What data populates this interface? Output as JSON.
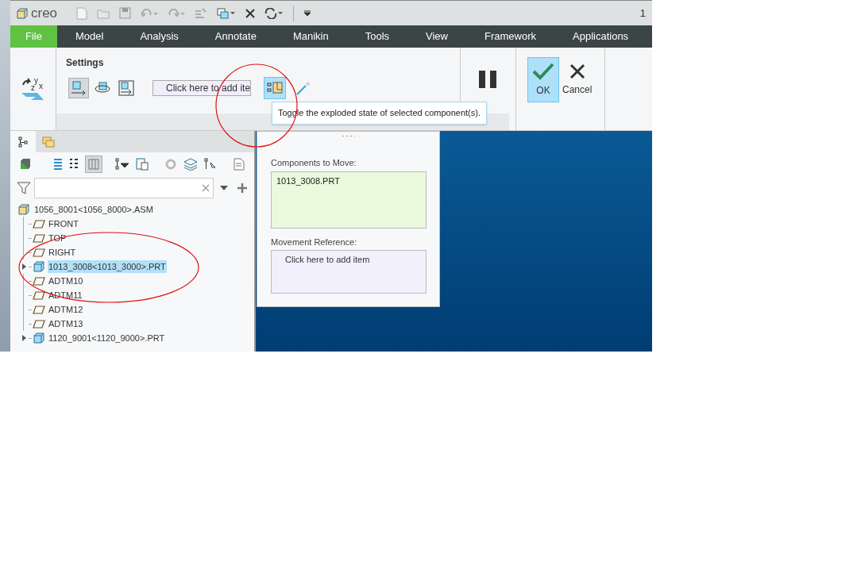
{
  "title_bar": {
    "logo": "creo",
    "edge_text": "1"
  },
  "menu": [
    {
      "label": "File",
      "kind": "file"
    },
    {
      "label": "Model",
      "kind": "tab"
    },
    {
      "label": "Analysis",
      "kind": "tab"
    },
    {
      "label": "Annotate",
      "kind": "tab"
    },
    {
      "label": "Manikin",
      "kind": "tab"
    },
    {
      "label": "Tools",
      "kind": "tab"
    },
    {
      "label": "View",
      "kind": "tab"
    },
    {
      "label": "Framework",
      "kind": "tab"
    },
    {
      "label": "Applications",
      "kind": "tab"
    }
  ],
  "ribbon": {
    "group_label": "Settings",
    "axis_letters": [
      "y",
      "z",
      "x"
    ],
    "motion_types": [
      {
        "kind": "translate",
        "selected": true
      },
      {
        "kind": "rotate",
        "selected": false
      },
      {
        "kind": "move",
        "selected": false
      }
    ],
    "reference_field": {
      "value": "Click here to add ite"
    },
    "toggle_explode": {
      "selected": true
    },
    "ok": {
      "label": "OK",
      "selected": true
    },
    "cancel": {
      "label": "Cancel"
    }
  },
  "tooltip": "Toggle the exploded state of selected component(s).",
  "tree": {
    "root": {
      "label": "1056_8001<1056_8000>.ASM",
      "children": [
        {
          "label": "FRONT",
          "kind": "datum",
          "selected": false
        },
        {
          "label": "TOP",
          "kind": "datum",
          "selected": false
        },
        {
          "label": "RIGHT",
          "kind": "datum",
          "selected": false
        },
        {
          "label": "1013_3008<1013_3000>.PRT",
          "kind": "part",
          "selected": true,
          "expanded": false
        },
        {
          "label": "ADTM10",
          "kind": "datum",
          "selected": false
        },
        {
          "label": "ADTM11",
          "kind": "datum",
          "selected": false
        },
        {
          "label": "ADTM12",
          "kind": "datum",
          "selected": false
        },
        {
          "label": "ADTM13",
          "kind": "datum",
          "selected": false
        },
        {
          "label": "1120_9001<1120_9000>.PRT",
          "kind": "part",
          "selected": false,
          "expanded": false
        }
      ]
    }
  },
  "panel": {
    "components_label": "Components to Move:",
    "components": [
      "1013_3008.PRT"
    ],
    "reference_label": "Movement Reference:",
    "reference_placeholder": "Click here to add item"
  }
}
